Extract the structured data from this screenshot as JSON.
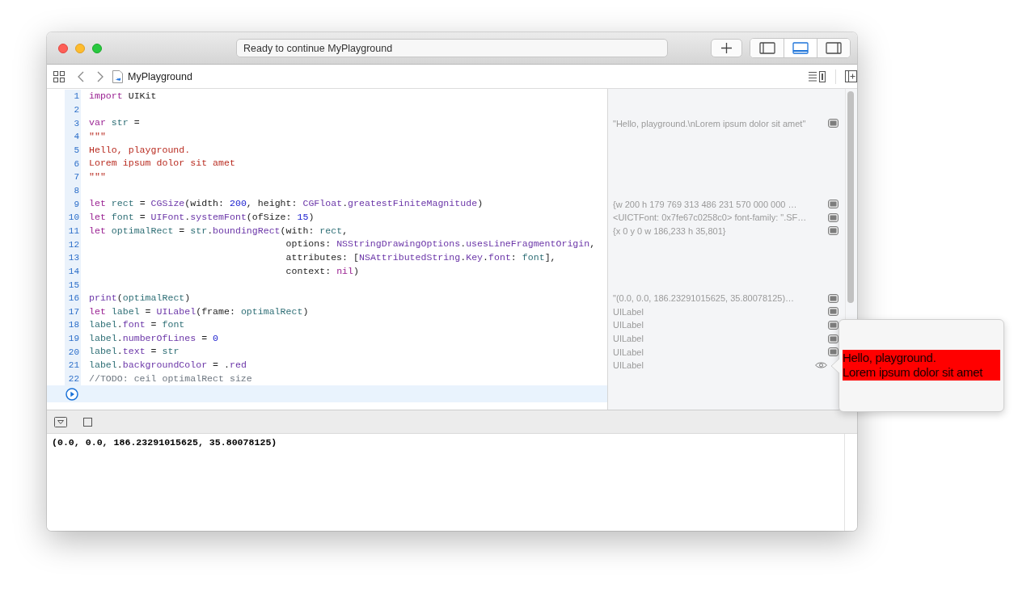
{
  "window": {
    "status": "Ready to continue MyPlayground"
  },
  "toolbar": {
    "panel_toggles": [
      {
        "kind": "left",
        "selected": false
      },
      {
        "kind": "bottom",
        "selected": true
      },
      {
        "kind": "right",
        "selected": false
      }
    ]
  },
  "jump_bar": {
    "file": "MyPlayground"
  },
  "editor": {
    "lines": [
      {
        "number": "1",
        "tokens": [
          {
            "kind": "keyword",
            "text": "import"
          },
          {
            "kind": "plain",
            "text": " UIKit"
          }
        ]
      },
      {
        "number": "2"
      },
      {
        "number": "3",
        "tokens": [
          {
            "kind": "keyword",
            "text": "var"
          },
          {
            "kind": "ident",
            "text": " str"
          },
          {
            "kind": "plain",
            "text": " ="
          }
        ],
        "result": {
          "text": "\"Hello, playground.\\nLorem ipsum dolor sit amet\"",
          "previewed": false
        }
      },
      {
        "number": "4",
        "tokens": [
          {
            "kind": "string",
            "text": "\"\"\""
          }
        ]
      },
      {
        "number": "5",
        "tokens": [
          {
            "kind": "string",
            "text": "Hello, playground."
          }
        ]
      },
      {
        "number": "6",
        "tokens": [
          {
            "kind": "string",
            "text": "Lorem ipsum dolor sit amet"
          }
        ]
      },
      {
        "number": "7",
        "tokens": [
          {
            "kind": "string",
            "text": "\"\"\""
          }
        ]
      },
      {
        "number": "8"
      },
      {
        "number": "9",
        "tokens": [
          {
            "kind": "keyword",
            "text": "let"
          },
          {
            "kind": "ident",
            "text": " rect"
          },
          {
            "kind": "plain",
            "text": " = "
          },
          {
            "kind": "api",
            "text": "CGSize"
          },
          {
            "kind": "plain",
            "text": "(width: "
          },
          {
            "kind": "number",
            "text": "200"
          },
          {
            "kind": "plain",
            "text": ", height: "
          },
          {
            "kind": "api",
            "text": "CGFloat"
          },
          {
            "kind": "plain",
            "text": "."
          },
          {
            "kind": "api",
            "text": "greatestFiniteMagnitude"
          },
          {
            "kind": "plain",
            "text": ")"
          }
        ],
        "result": {
          "text": "{w 200 h 179 769 313 486 231 570 000 000 …",
          "previewed": false
        }
      },
      {
        "number": "10",
        "tokens": [
          {
            "kind": "keyword",
            "text": "let"
          },
          {
            "kind": "ident",
            "text": " font"
          },
          {
            "kind": "plain",
            "text": " = "
          },
          {
            "kind": "api",
            "text": "UIFont"
          },
          {
            "kind": "plain",
            "text": "."
          },
          {
            "kind": "api",
            "text": "systemFont"
          },
          {
            "kind": "plain",
            "text": "(ofSize: "
          },
          {
            "kind": "number",
            "text": "15"
          },
          {
            "kind": "plain",
            "text": ")"
          }
        ],
        "result": {
          "text": "<UICTFont: 0x7fe67c0258c0> font-family: \".SF…",
          "previewed": false
        }
      },
      {
        "number": "11",
        "tokens": [
          {
            "kind": "keyword",
            "text": "let"
          },
          {
            "kind": "ident",
            "text": " optimalRect"
          },
          {
            "kind": "plain",
            "text": " = "
          },
          {
            "kind": "ident",
            "text": "str"
          },
          {
            "kind": "plain",
            "text": "."
          },
          {
            "kind": "api",
            "text": "boundingRect"
          },
          {
            "kind": "plain",
            "text": "(with: "
          },
          {
            "kind": "ident",
            "text": "rect"
          },
          {
            "kind": "plain",
            "text": ","
          }
        ],
        "result": {
          "text": "{x 0 y 0 w 186,233 h 35,801}",
          "previewed": false
        }
      },
      {
        "number": "12",
        "tokens": [
          {
            "kind": "plain",
            "text": "                                   options: "
          },
          {
            "kind": "api",
            "text": "NSStringDrawingOptions"
          },
          {
            "kind": "plain",
            "text": "."
          },
          {
            "kind": "api",
            "text": "usesLineFragmentOrigin"
          },
          {
            "kind": "plain",
            "text": ","
          }
        ]
      },
      {
        "number": "13",
        "tokens": [
          {
            "kind": "plain",
            "text": "                                   attributes: ["
          },
          {
            "kind": "api",
            "text": "NSAttributedString"
          },
          {
            "kind": "plain",
            "text": "."
          },
          {
            "kind": "api",
            "text": "Key"
          },
          {
            "kind": "plain",
            "text": "."
          },
          {
            "kind": "api",
            "text": "font"
          },
          {
            "kind": "plain",
            "text": ": "
          },
          {
            "kind": "ident",
            "text": "font"
          },
          {
            "kind": "plain",
            "text": "],"
          }
        ]
      },
      {
        "number": "14",
        "tokens": [
          {
            "kind": "plain",
            "text": "                                   context: "
          },
          {
            "kind": "keyword",
            "text": "nil"
          },
          {
            "kind": "plain",
            "text": ")"
          }
        ]
      },
      {
        "number": "15"
      },
      {
        "number": "16",
        "tokens": [
          {
            "kind": "api",
            "text": "print"
          },
          {
            "kind": "plain",
            "text": "("
          },
          {
            "kind": "ident",
            "text": "optimalRect"
          },
          {
            "kind": "plain",
            "text": ")"
          }
        ],
        "result": {
          "text": "\"(0.0, 0.0, 186.23291015625, 35.80078125)…",
          "previewed": false
        }
      },
      {
        "number": "17",
        "tokens": [
          {
            "kind": "keyword",
            "text": "let"
          },
          {
            "kind": "ident",
            "text": " label"
          },
          {
            "kind": "plain",
            "text": " = "
          },
          {
            "kind": "api",
            "text": "UILabel"
          },
          {
            "kind": "plain",
            "text": "(frame: "
          },
          {
            "kind": "ident",
            "text": "optimalRect"
          },
          {
            "kind": "plain",
            "text": ")"
          }
        ],
        "result": {
          "text": "UILabel",
          "previewed": false
        }
      },
      {
        "number": "18",
        "tokens": [
          {
            "kind": "ident",
            "text": "label"
          },
          {
            "kind": "plain",
            "text": "."
          },
          {
            "kind": "api",
            "text": "font"
          },
          {
            "kind": "plain",
            "text": " = "
          },
          {
            "kind": "ident",
            "text": "font"
          }
        ],
        "result": {
          "text": "UILabel",
          "previewed": false
        }
      },
      {
        "number": "19",
        "tokens": [
          {
            "kind": "ident",
            "text": "label"
          },
          {
            "kind": "plain",
            "text": "."
          },
          {
            "kind": "api",
            "text": "numberOfLines"
          },
          {
            "kind": "plain",
            "text": " = "
          },
          {
            "kind": "number",
            "text": "0"
          }
        ],
        "result": {
          "text": "UILabel",
          "previewed": false
        }
      },
      {
        "number": "20",
        "tokens": [
          {
            "kind": "ident",
            "text": "label"
          },
          {
            "kind": "plain",
            "text": "."
          },
          {
            "kind": "api",
            "text": "text"
          },
          {
            "kind": "plain",
            "text": " = "
          },
          {
            "kind": "ident",
            "text": "str"
          }
        ],
        "result": {
          "text": "UILabel",
          "previewed": false
        }
      },
      {
        "number": "21",
        "tokens": [
          {
            "kind": "ident",
            "text": "label"
          },
          {
            "kind": "plain",
            "text": "."
          },
          {
            "kind": "api",
            "text": "backgroundColor"
          },
          {
            "kind": "plain",
            "text": " = ."
          },
          {
            "kind": "api",
            "text": "red"
          }
        ],
        "result": {
          "text": "UILabel",
          "previewed": true
        }
      },
      {
        "number": "22",
        "tokens": [
          {
            "kind": "comment",
            "text": "//TODO: ceil optimalRect size"
          }
        ]
      }
    ]
  },
  "preview": {
    "lines": [
      "Hello, playground.",
      "Lorem ipsum dolor sit amet"
    ]
  },
  "console": {
    "output": "(0.0, 0.0, 186.23291015625, 35.80078125)"
  }
}
